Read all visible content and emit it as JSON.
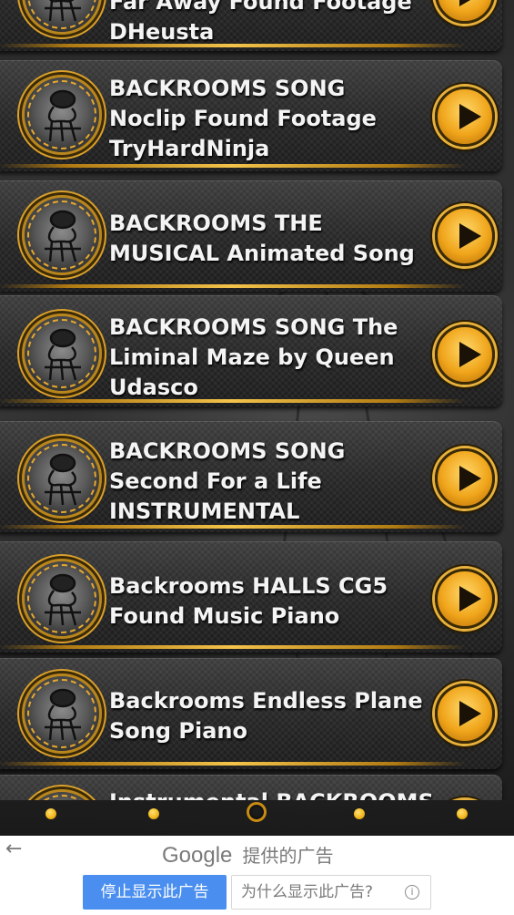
{
  "songs": [
    {
      "title_lines": [
        "Far Away Found Footage",
        "DHeusta"
      ]
    },
    {
      "title_lines": [
        "BACKROOMS SONG",
        "Noclip Found Footage",
        "TryHardNinja"
      ]
    },
    {
      "title_lines": [
        "BACKROOMS THE",
        "MUSICAL Animated Song"
      ]
    },
    {
      "title_lines": [
        "BACKROOMS SONG The",
        "Liminal Maze by Queen",
        "Udasco"
      ]
    },
    {
      "title_lines": [
        "BACKROOMS SONG",
        "Second For a Life",
        "INSTRUMENTAL"
      ]
    },
    {
      "title_lines": [
        "Backrooms HALLS CG5",
        "Found Music Piano"
      ]
    },
    {
      "title_lines": [
        "Backrooms Endless Plane",
        "Song Piano"
      ]
    },
    {
      "title_lines": [
        "Instrumental BACKROOMS"
      ]
    }
  ],
  "pager": {
    "count": 5,
    "active_index": 2,
    "color": "#f2b51b"
  },
  "ad": {
    "brand": "Google",
    "provided_text": "提供的广告",
    "stop_button": "停止显示此广告",
    "why_button": "为什么显示此广告?",
    "back_icon": "back-arrow-icon",
    "info_icon": "info-icon"
  },
  "colors": {
    "accent": "#f0a51b",
    "ad_button": "#4a8ef0"
  }
}
